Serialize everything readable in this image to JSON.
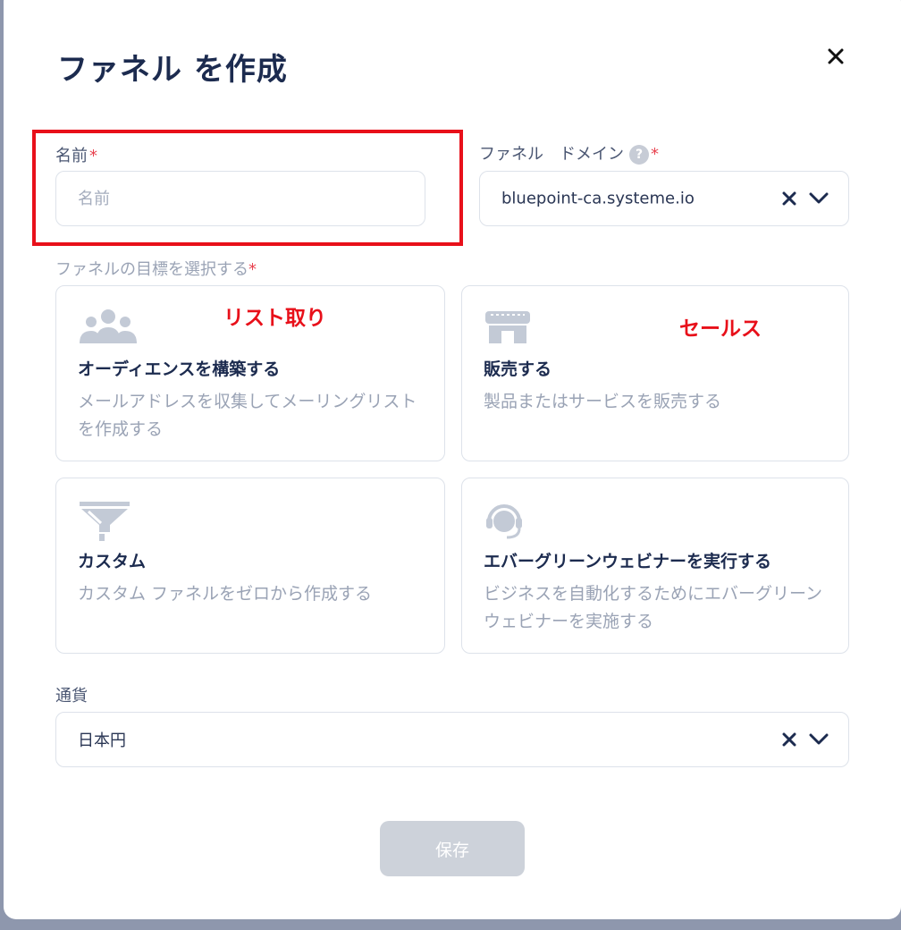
{
  "modal": {
    "title": "ファネル を作成",
    "close_icon": "close-icon"
  },
  "name_field": {
    "label": "名前",
    "required_mark": "*",
    "placeholder": "名前",
    "value": ""
  },
  "domain_field": {
    "label": "ファネル　ドメイン",
    "help_icon": "question-circle-icon",
    "help_glyph": "?",
    "required_mark": "*",
    "value": "bluepoint-ca.systeme.io"
  },
  "goal": {
    "label": "ファネルの目標を選択する",
    "required_mark": "*",
    "options": [
      {
        "icon": "audience-group-icon",
        "title": "オーディエンスを構築する",
        "description": "メールアドレスを収集してメーリングリストを作成する"
      },
      {
        "icon": "storefront-icon",
        "title": "販売する",
        "description": "製品またはサービスを販売する"
      },
      {
        "icon": "funnel-icon",
        "title": "カスタム",
        "description": "カスタム ファネルをゼロから作成する"
      },
      {
        "icon": "headset-webinar-icon",
        "title": "エバーグリーンウェビナーを実行する",
        "description": "ビジネスを自動化するためにエバーグリーンウェビナーを実施する"
      }
    ]
  },
  "currency_field": {
    "label": "通貨",
    "value": "日本円"
  },
  "footer": {
    "save_label": "保存"
  },
  "annotations": {
    "list_acquisition": "リスト取り",
    "sales": "セールス",
    "highlight_color": "#e8101a"
  },
  "colors": {
    "title": "#1c2b4f",
    "required": "#e8424f",
    "save_disabled": "#cdd2da"
  }
}
